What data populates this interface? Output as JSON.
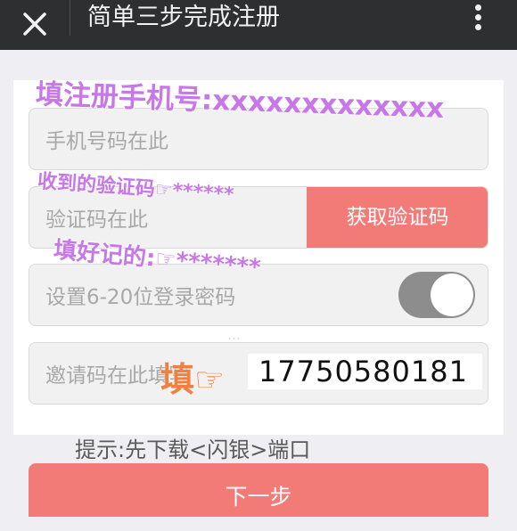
{
  "header": {
    "title": "简单三步完成注册"
  },
  "form": {
    "phone_placeholder": "手机号码在此",
    "code_placeholder": "验证码在此",
    "code_button": "获取验证码",
    "password_placeholder": "设置6-20位登录密码",
    "invite_placeholder": "邀请码在此填写"
  },
  "annotations": {
    "phone_note": "填注册手机号:xxxxxxxxxxxxx",
    "code_note": "收到的验证码☞******",
    "password_note": "填好记的:☞*******",
    "invite_note": "填☞",
    "invite_number": "17750580181"
  },
  "footer": {
    "hint": "提示:先下载<闪银>端口",
    "next_button": "下一步"
  },
  "watermark": "…",
  "colors": {
    "accent": "#f27b78",
    "topbar": "#2d2f31",
    "annotation": "#c777e8",
    "annotation_ref": "#f27f3f"
  }
}
